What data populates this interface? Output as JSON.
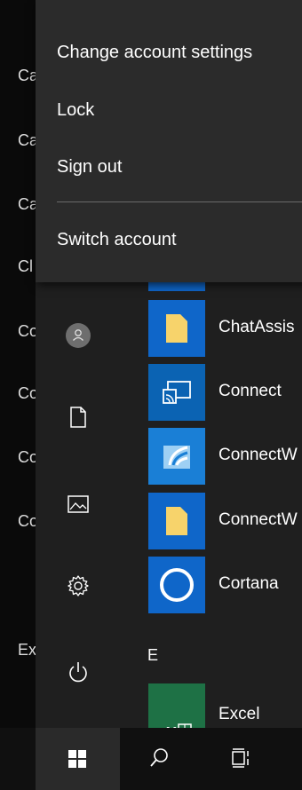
{
  "background_list": [
    "Ca",
    "Ca",
    "Ca",
    "Cl",
    "Co",
    "Co",
    "Co",
    "Co",
    "Ex"
  ],
  "popup": {
    "items": [
      "Change account settings",
      "Lock",
      "Sign out",
      "Switch account"
    ]
  },
  "apps": [
    {
      "name": "ChatAssis",
      "tile_color": "#0f66c9",
      "icon": "folder-icon"
    },
    {
      "name": "Connect",
      "tile_color": "#0b63b3",
      "icon": "cast-icon"
    },
    {
      "name": "ConnectW",
      "tile_color": "#1a7fd6",
      "icon": "wireless-display-icon"
    },
    {
      "name": "ConnectW",
      "tile_color": "#0f66c9",
      "icon": "folder-icon"
    },
    {
      "name": "Cortana",
      "tile_color": "#0f66c9",
      "icon": "cortana-icon"
    },
    {
      "name": "Excel",
      "tile_color": "#1e7145",
      "icon": "excel-icon"
    }
  ],
  "section_letter": "E",
  "rail": {
    "icons": [
      "avatar",
      "document-icon",
      "pictures-icon",
      "settings-icon",
      "power-icon"
    ]
  },
  "taskbar": {
    "icons": [
      "windows-start-icon",
      "search-icon",
      "task-view-icon"
    ]
  },
  "colors": {
    "menu_bg": "#1f1f1f",
    "popup_bg": "#2b2b2b",
    "tile_blue": "#0f66c9",
    "excel_green": "#1e7145",
    "taskbar_bg": "#101010"
  }
}
